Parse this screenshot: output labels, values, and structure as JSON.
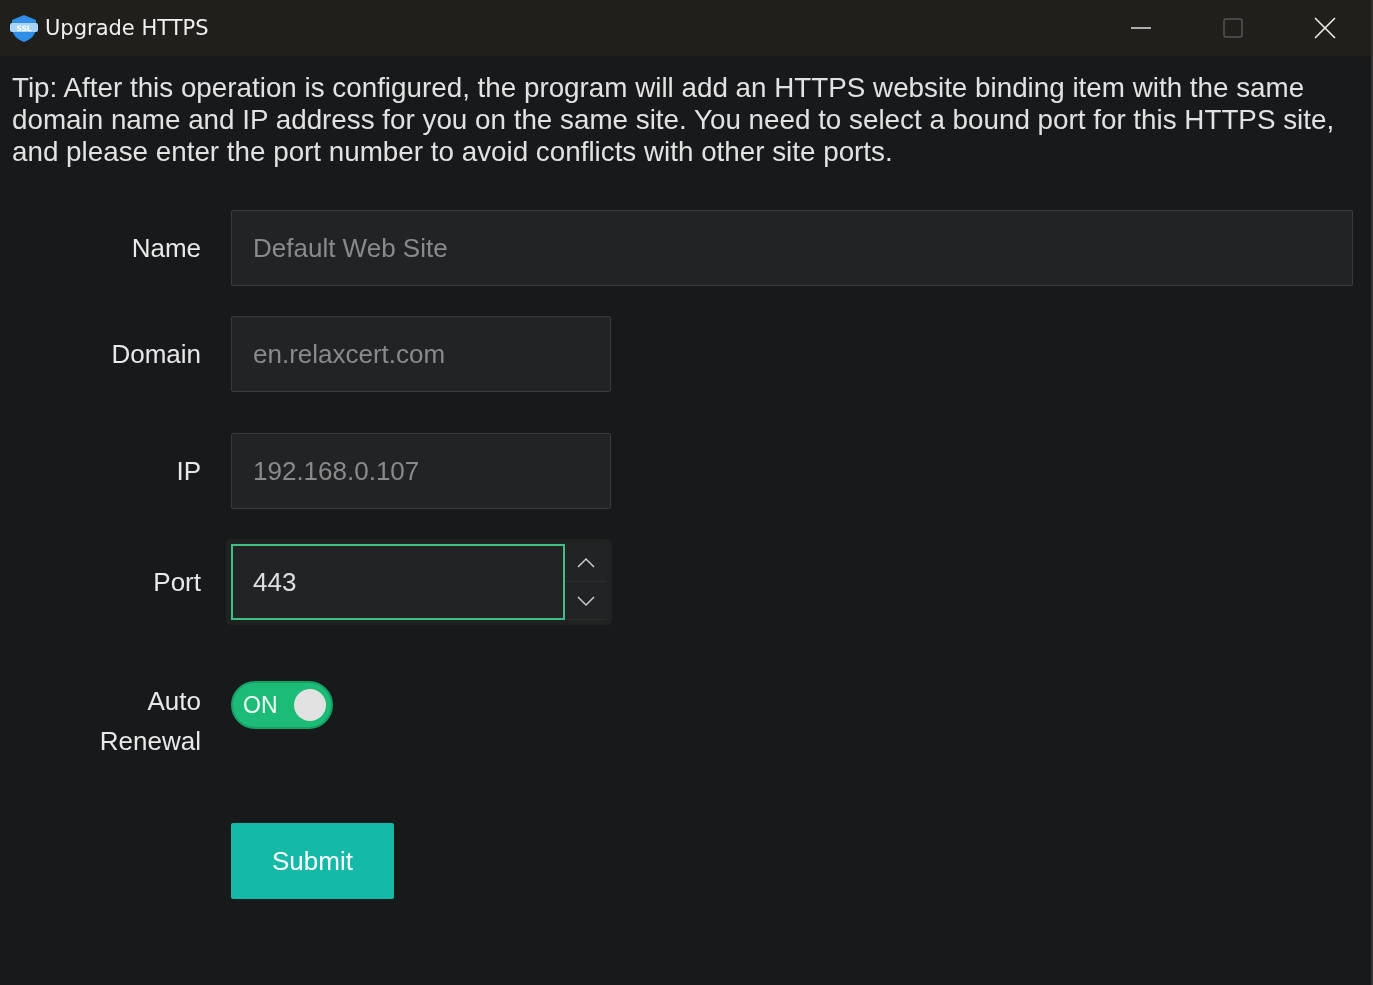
{
  "window": {
    "title": "Upgrade HTTPS",
    "icon_text": "SSL"
  },
  "tip": "Tip: After this operation is configured, the program will add an HTTPS website binding item with the same domain name and IP address for you on the same site. You need to select a bound port for this HTTPS site, and please enter the port number to avoid conflicts with other site ports.",
  "fields": [
    {
      "kind": "text",
      "label": "Name",
      "value": "Default Web Site",
      "disabled": true,
      "wide": true
    },
    {
      "kind": "text",
      "label": "Domain",
      "value": "en.relaxcert.com",
      "disabled": true,
      "wide": false
    },
    {
      "kind": "text",
      "label": "IP",
      "value": "192.168.0.107",
      "disabled": true,
      "wide": false
    },
    {
      "kind": "number",
      "label": "Port",
      "value": "443",
      "focused": true
    },
    {
      "kind": "switch",
      "label": "Auto Renewal",
      "on": true,
      "text": "ON"
    }
  ],
  "submit": "Submit"
}
